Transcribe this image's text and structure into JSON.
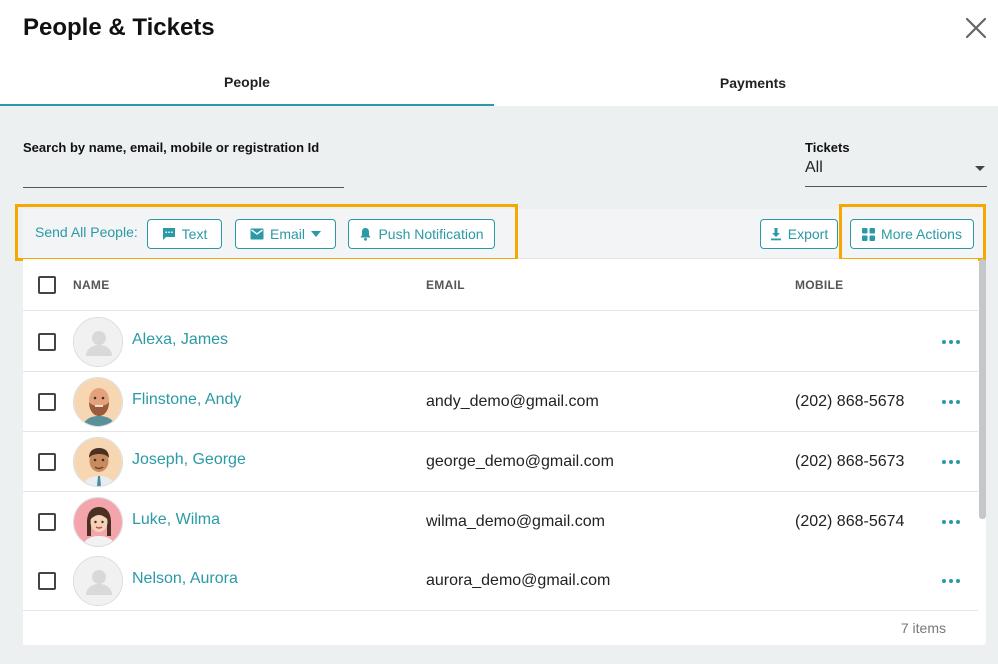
{
  "header": {
    "title": "People & Tickets"
  },
  "tabs": [
    {
      "label": "People",
      "active": true
    },
    {
      "label": "Payments",
      "active": false
    }
  ],
  "search": {
    "label": "Search by name, email, mobile or registration Id",
    "value": "",
    "placeholder": ""
  },
  "tickets": {
    "label": "Tickets",
    "value": "All"
  },
  "toolbar": {
    "send_all_label": "Send All People:",
    "text_button": "Text",
    "email_button": "Email",
    "push_button": "Push Notification",
    "export_button": "Export",
    "more_actions_button": "More Actions"
  },
  "table": {
    "columns": [
      "NAME",
      "EMAIL",
      "MOBILE"
    ],
    "rows": [
      {
        "name": "Alexa, James",
        "email": "",
        "mobile": "",
        "avatar": "placeholder"
      },
      {
        "name": "Flinstone, Andy",
        "email": "andy_demo@gmail.com",
        "mobile": "(202) 868-5678",
        "avatar": "bearded-man"
      },
      {
        "name": "Joseph, George",
        "email": "george_demo@gmail.com",
        "mobile": "(202) 868-5673",
        "avatar": "man-tie"
      },
      {
        "name": "Luke, Wilma",
        "email": "wilma_demo@gmail.com",
        "mobile": "(202) 868-5674",
        "avatar": "woman-braid"
      },
      {
        "name": "Nelson, Aurora",
        "email": "aurora_demo@gmail.com",
        "mobile": "",
        "avatar": "placeholder"
      }
    ]
  },
  "footer": {
    "item_count": "7 items"
  },
  "colors": {
    "accent": "#2a9aa6",
    "highlight": "#f5a800",
    "background": "#ecf0f1"
  }
}
